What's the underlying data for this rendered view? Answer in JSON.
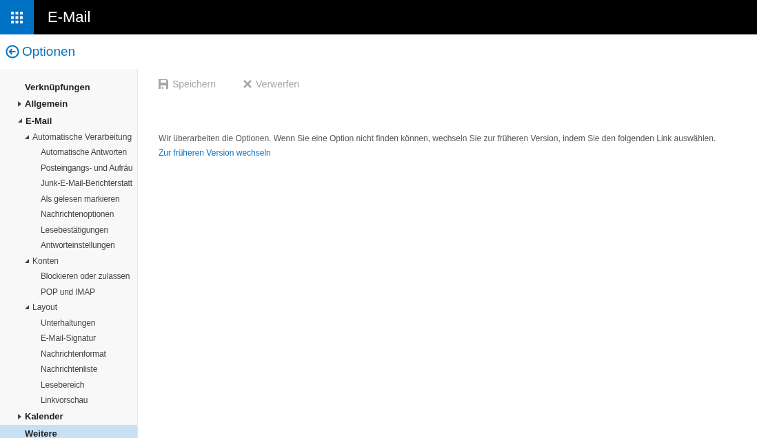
{
  "app_bar": {
    "title": "E-Mail"
  },
  "header": {
    "title": "Optionen"
  },
  "sidebar": {
    "items": [
      {
        "label": "Verknüpfungen",
        "selected": false
      },
      {
        "label": "Allgemein",
        "selected": false,
        "expanded": false
      },
      {
        "label": "E-Mail",
        "selected": false,
        "expanded": true,
        "children": [
          {
            "label": "Automatische Verarbeitung",
            "selected": false,
            "expanded": true,
            "children": [
              {
                "label": "Automatische Antworten",
                "selected": false
              },
              {
                "label": "Posteingangs- und Aufräu",
                "selected": false
              },
              {
                "label": "Junk-E-Mail-Berichterstatt",
                "selected": false
              },
              {
                "label": "Als gelesen markieren",
                "selected": false
              },
              {
                "label": "Nachrichtenoptionen",
                "selected": false
              },
              {
                "label": "Lesebestätigungen",
                "selected": false
              },
              {
                "label": "Antworteinstellungen",
                "selected": false
              }
            ]
          },
          {
            "label": "Konten",
            "selected": false,
            "expanded": true,
            "children": [
              {
                "label": "Blockieren oder zulassen",
                "selected": false
              },
              {
                "label": "POP und IMAP",
                "selected": false
              }
            ]
          },
          {
            "label": "Layout",
            "selected": false,
            "expanded": true,
            "children": [
              {
                "label": "Unterhaltungen",
                "selected": false
              },
              {
                "label": "E-Mail-Signatur",
                "selected": false
              },
              {
                "label": "Nachrichtenformat",
                "selected": false
              },
              {
                "label": "Nachrichtenliste",
                "selected": false
              },
              {
                "label": "Lesebereich",
                "selected": false
              },
              {
                "label": "Linkvorschau",
                "selected": false
              }
            ]
          }
        ]
      },
      {
        "label": "Kalender",
        "selected": false,
        "expanded": false
      },
      {
        "label": "Weitere",
        "selected": true
      }
    ]
  },
  "toolbar": {
    "buttons": [
      {
        "kind": "save",
        "label": "Speichern",
        "disabled": true
      },
      {
        "kind": "discard",
        "label": "Verwerfen",
        "disabled": true
      }
    ]
  },
  "notice": {
    "text": "Wir überarbeiten die Optionen. Wenn Sie eine Option nicht finden können, wechseln Sie zur früheren Version, indem Sie den folgenden Link auswählen.",
    "link": "Zur früheren Version wechseln"
  }
}
